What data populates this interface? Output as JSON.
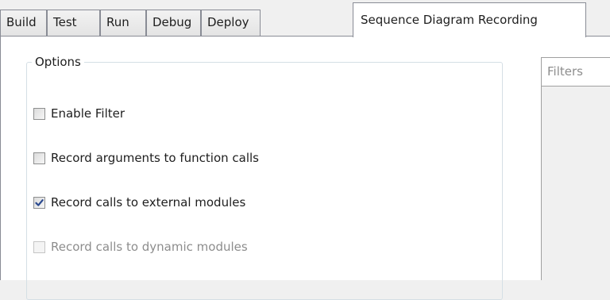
{
  "tabs": [
    {
      "label": "Build"
    },
    {
      "label": "Test"
    },
    {
      "label": "Run"
    },
    {
      "label": "Debug"
    },
    {
      "label": "Deploy"
    },
    {
      "label": "Sequence Diagram Recording",
      "active": true
    }
  ],
  "options_group": {
    "title": "Options",
    "items": [
      {
        "label": "Enable Filter",
        "checked": false,
        "enabled": true
      },
      {
        "label": "Record arguments to function calls",
        "checked": false,
        "enabled": true
      },
      {
        "label": "Record calls to external modules",
        "checked": true,
        "enabled": true
      },
      {
        "label": "Record calls to dynamic modules",
        "checked": false,
        "enabled": false
      }
    ]
  },
  "filters": {
    "header": "Filters"
  },
  "colors": {
    "check_mark": "#2b4a8f",
    "disabled_text": "#8d8d8d",
    "tab_border": "#898c95"
  },
  "icons": {
    "check": "check-icon"
  }
}
